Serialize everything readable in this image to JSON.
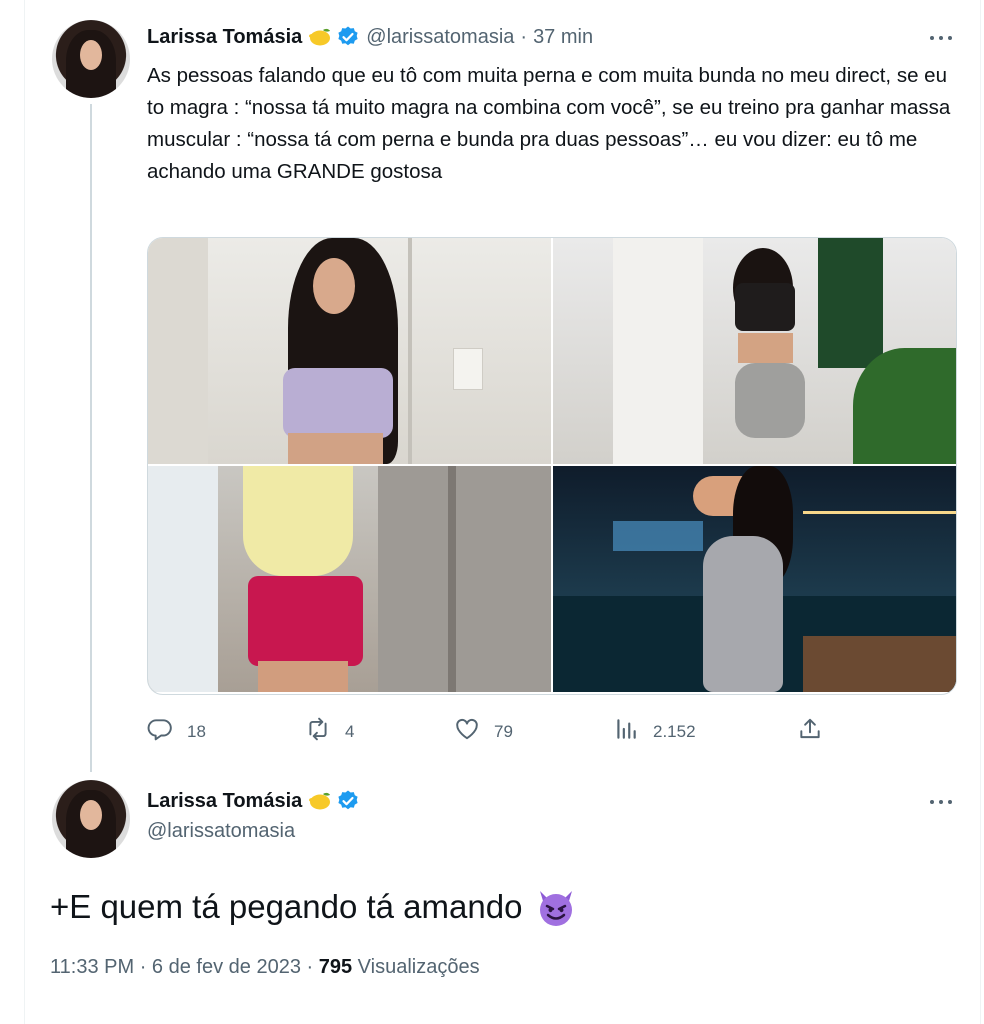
{
  "tweet": {
    "author_name": "Larissa Tomásia",
    "author_handle": "@larissatomasia",
    "time_ago": "37 min",
    "text": "As pessoas falando que eu tô com muita perna e com muita bunda no meu direct, se eu to magra : “nossa tá muito magra na combina com você”, se eu treino pra ganhar massa muscular : “nossa tá com perna e bunda pra duas pessoas”… eu vou dizer: eu tô me achando uma GRANDE gostosa",
    "replies": "18",
    "retweets": "4",
    "likes": "79",
    "views": "2.152"
  },
  "reply": {
    "author_name": "Larissa Tomásia",
    "author_handle": "@larissatomasia",
    "text": "+E quem tá pegando tá amando",
    "time": "11:33 PM",
    "date": "6 de fev de 2023",
    "views_count": "795",
    "views_label": "Visualizações",
    "separator": "·"
  },
  "icons": {
    "name_emoji": "lemon-emoji",
    "verified": "verified-badge-icon",
    "more": "more-icon",
    "reply": "reply-icon",
    "retweet": "retweet-icon",
    "like": "heart-icon",
    "views": "analytics-icon",
    "share": "share-icon",
    "reply_emoji": "smiling-devil-emoji"
  },
  "colors": {
    "verified": "#1d9bf0",
    "secondary_text": "#536471",
    "primary_text": "#0f1419",
    "thread_line": "#cfd9de"
  }
}
